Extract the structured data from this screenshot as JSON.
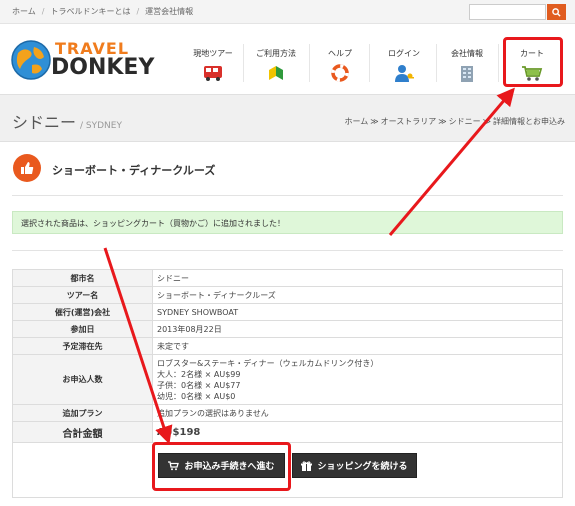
{
  "topbar": {
    "breadcrumbs": [
      "ホーム",
      "トラベルドンキーとは",
      "運営会社情報"
    ],
    "separator": "/"
  },
  "logo": {
    "line1": "TRAVEL",
    "line2": "DONKEY"
  },
  "nav": {
    "items": [
      {
        "label": "現地ツアー",
        "icon": "bus-icon"
      },
      {
        "label": "ご利用方法",
        "icon": "beginner-mark-icon"
      },
      {
        "label": "ヘルプ",
        "icon": "lifebuoy-icon"
      },
      {
        "label": "ログイン",
        "icon": "user-key-icon"
      },
      {
        "label": "会社情報",
        "icon": "building-icon"
      },
      {
        "label": "カート",
        "icon": "cart-icon"
      }
    ]
  },
  "page": {
    "title": "シドニー",
    "subtitle": "/ SYDNEY",
    "breadcrumbs": [
      "ホーム",
      "オーストラリア",
      "シドニー",
      "詳細情報とお申込み"
    ]
  },
  "product": {
    "title": "ショーボート・ディナークルーズ"
  },
  "alert": {
    "message": "選択された商品は、ショッピングカート（買物かご）に追加されました！"
  },
  "details": {
    "rows": [
      {
        "label": "都市名",
        "value": "シドニー"
      },
      {
        "label": "ツアー名",
        "value": "ショーボート・ディナークルーズ"
      },
      {
        "label": "催行(運営)会社",
        "value": "SYDNEY SHOWBOAT"
      },
      {
        "label": "参加日",
        "value": "2013年08月22日"
      },
      {
        "label": "予定滞在先",
        "value": "未定です"
      }
    ],
    "applicants_label": "お申込人数",
    "applicants_lines": [
      "ロブスター&ステーキ・ディナー（ウェルカムドリンク付き）",
      "大人：2名様 × AU$99",
      "子供：0名様 × AU$77",
      "幼児：0名様 × AU$0"
    ],
    "addon_label": "追加プラン",
    "addon_value": "追加プランの選択はありません",
    "total_label": "合計金額",
    "total_value": "AU$198"
  },
  "buttons": {
    "proceed": "お申込み手続きへ進む",
    "continue": "ショッピングを続ける"
  },
  "colors": {
    "accent": "#e9591e",
    "highlight": "#e8181c",
    "alert_bg": "#dff7d9",
    "button_bg": "#333333"
  }
}
